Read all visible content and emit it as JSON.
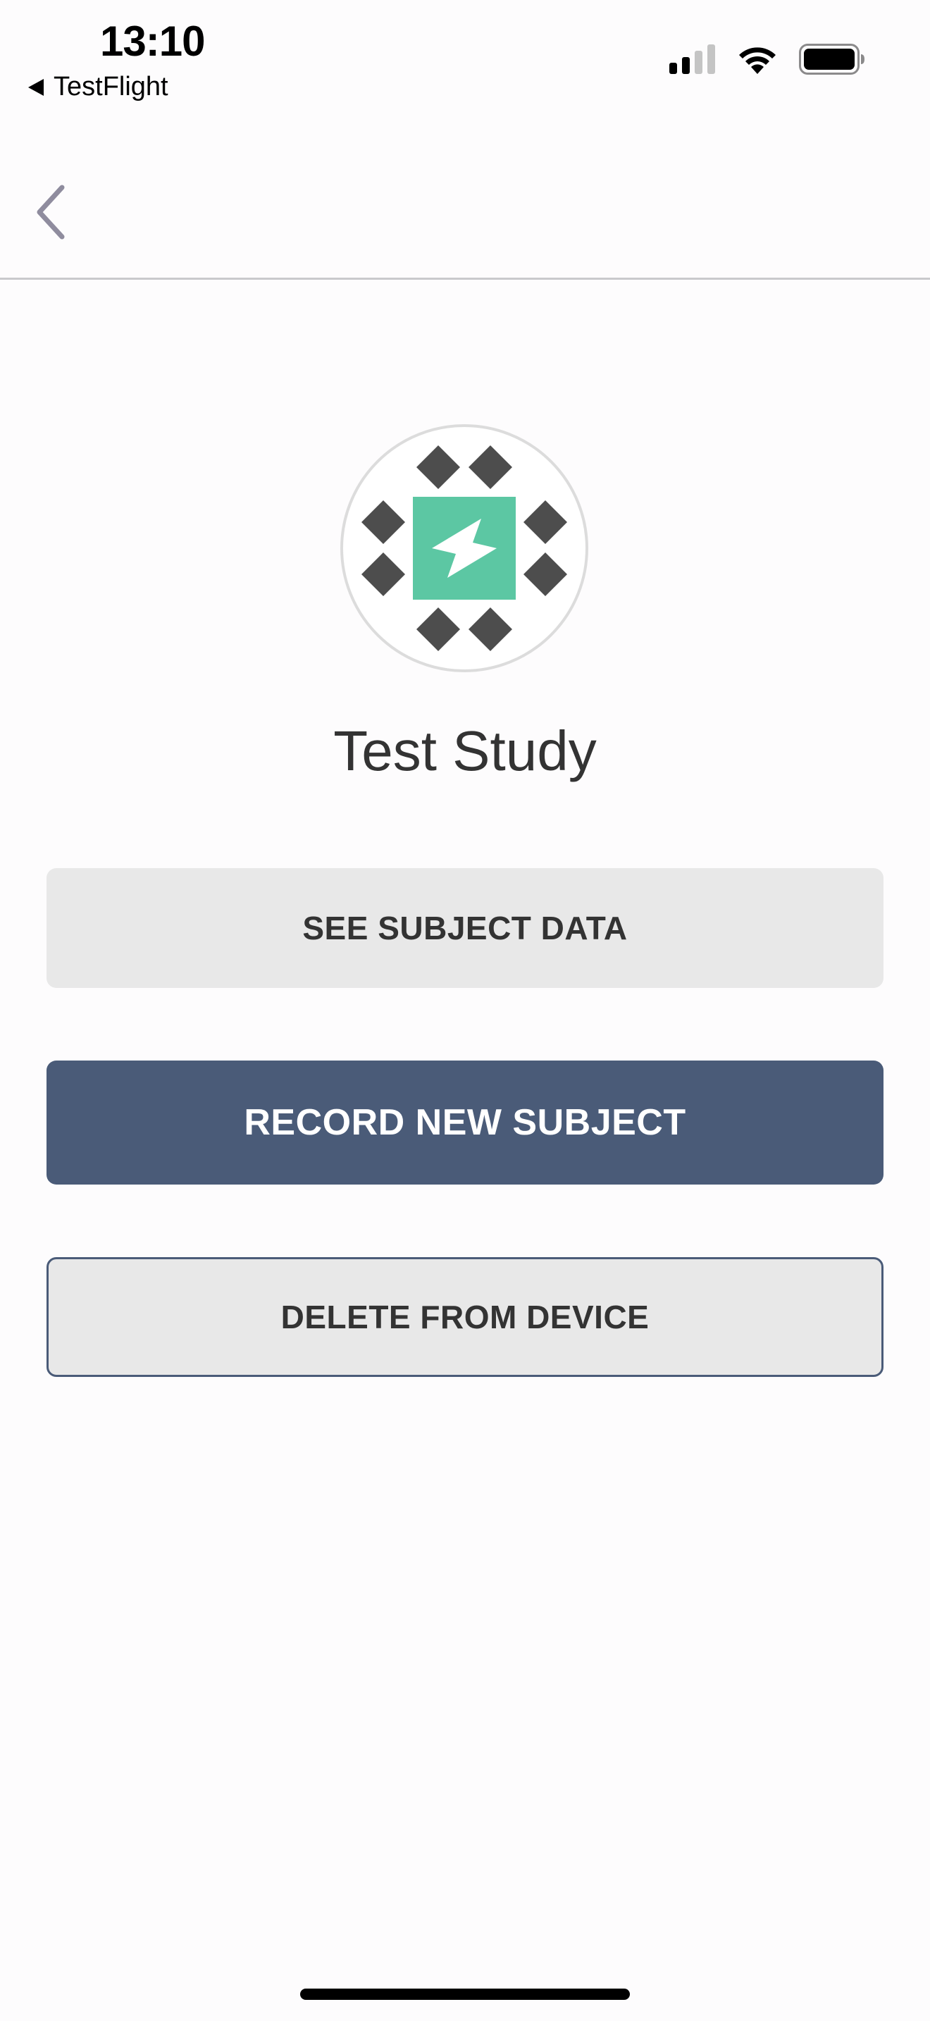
{
  "status_bar": {
    "time": "13:10",
    "back_app_label": "TestFlight",
    "icons": [
      "signal-icon",
      "wifi-icon",
      "battery-icon"
    ]
  },
  "nav": {
    "back_icon": "chevron-left-icon"
  },
  "study": {
    "title": "Test Study",
    "logo_icon": "study-logo-icon"
  },
  "actions": {
    "see_subject_data_label": "SEE SUBJECT DATA",
    "record_new_subject_label": "RECORD NEW SUBJECT",
    "delete_from_device_label": "DELETE FROM DEVICE"
  },
  "colors": {
    "primary": "#4a5b78",
    "button_bg": "#e8e8e8",
    "logo_accent": "#5cc7a3",
    "logo_dark": "#4d4d4d"
  }
}
